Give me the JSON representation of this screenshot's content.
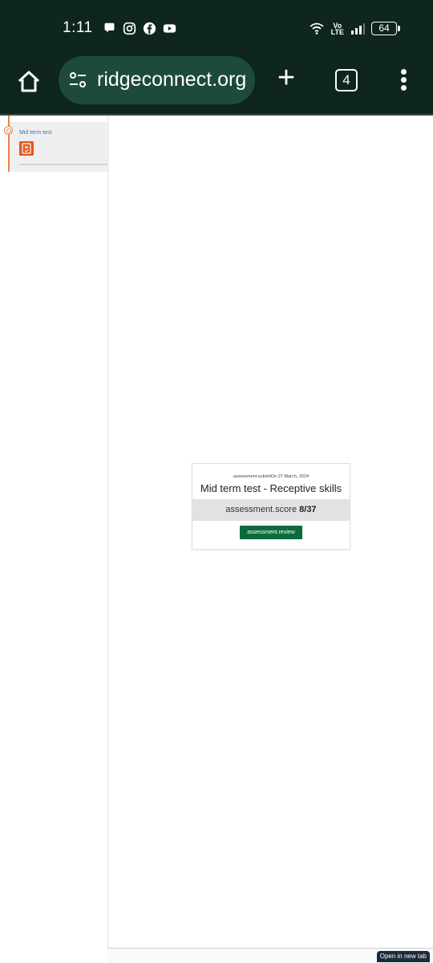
{
  "status_bar": {
    "time": "1:11",
    "left_icons": [
      "chat-bubble-icon",
      "instagram-icon",
      "facebook-icon",
      "youtube-icon"
    ],
    "right_icons": [
      "wifi-icon",
      "volte-icon",
      "signal-icon",
      "battery-icon"
    ],
    "volte_label": "Vo LTE",
    "battery": "64"
  },
  "browser": {
    "url": "ridgeconnect.org",
    "tab_count": "4",
    "new_tab_symbol": "+",
    "colors": {
      "bar": "#0e2520",
      "pill": "#1e4a3e"
    }
  },
  "sidebar": {
    "items": [
      {
        "label": "Mid term test",
        "icon": "test-document-icon"
      }
    ]
  },
  "result_card": {
    "submit_line": "assessment.submitOn 27 March, 2024",
    "title": "Mid term test - Receptive skills",
    "score_label": "assessment.score",
    "score_value": "8/37",
    "review_button": "assessment.review",
    "accent": "#0c6b3c"
  },
  "footer": {
    "open_new_tab": "Open in new tab"
  }
}
